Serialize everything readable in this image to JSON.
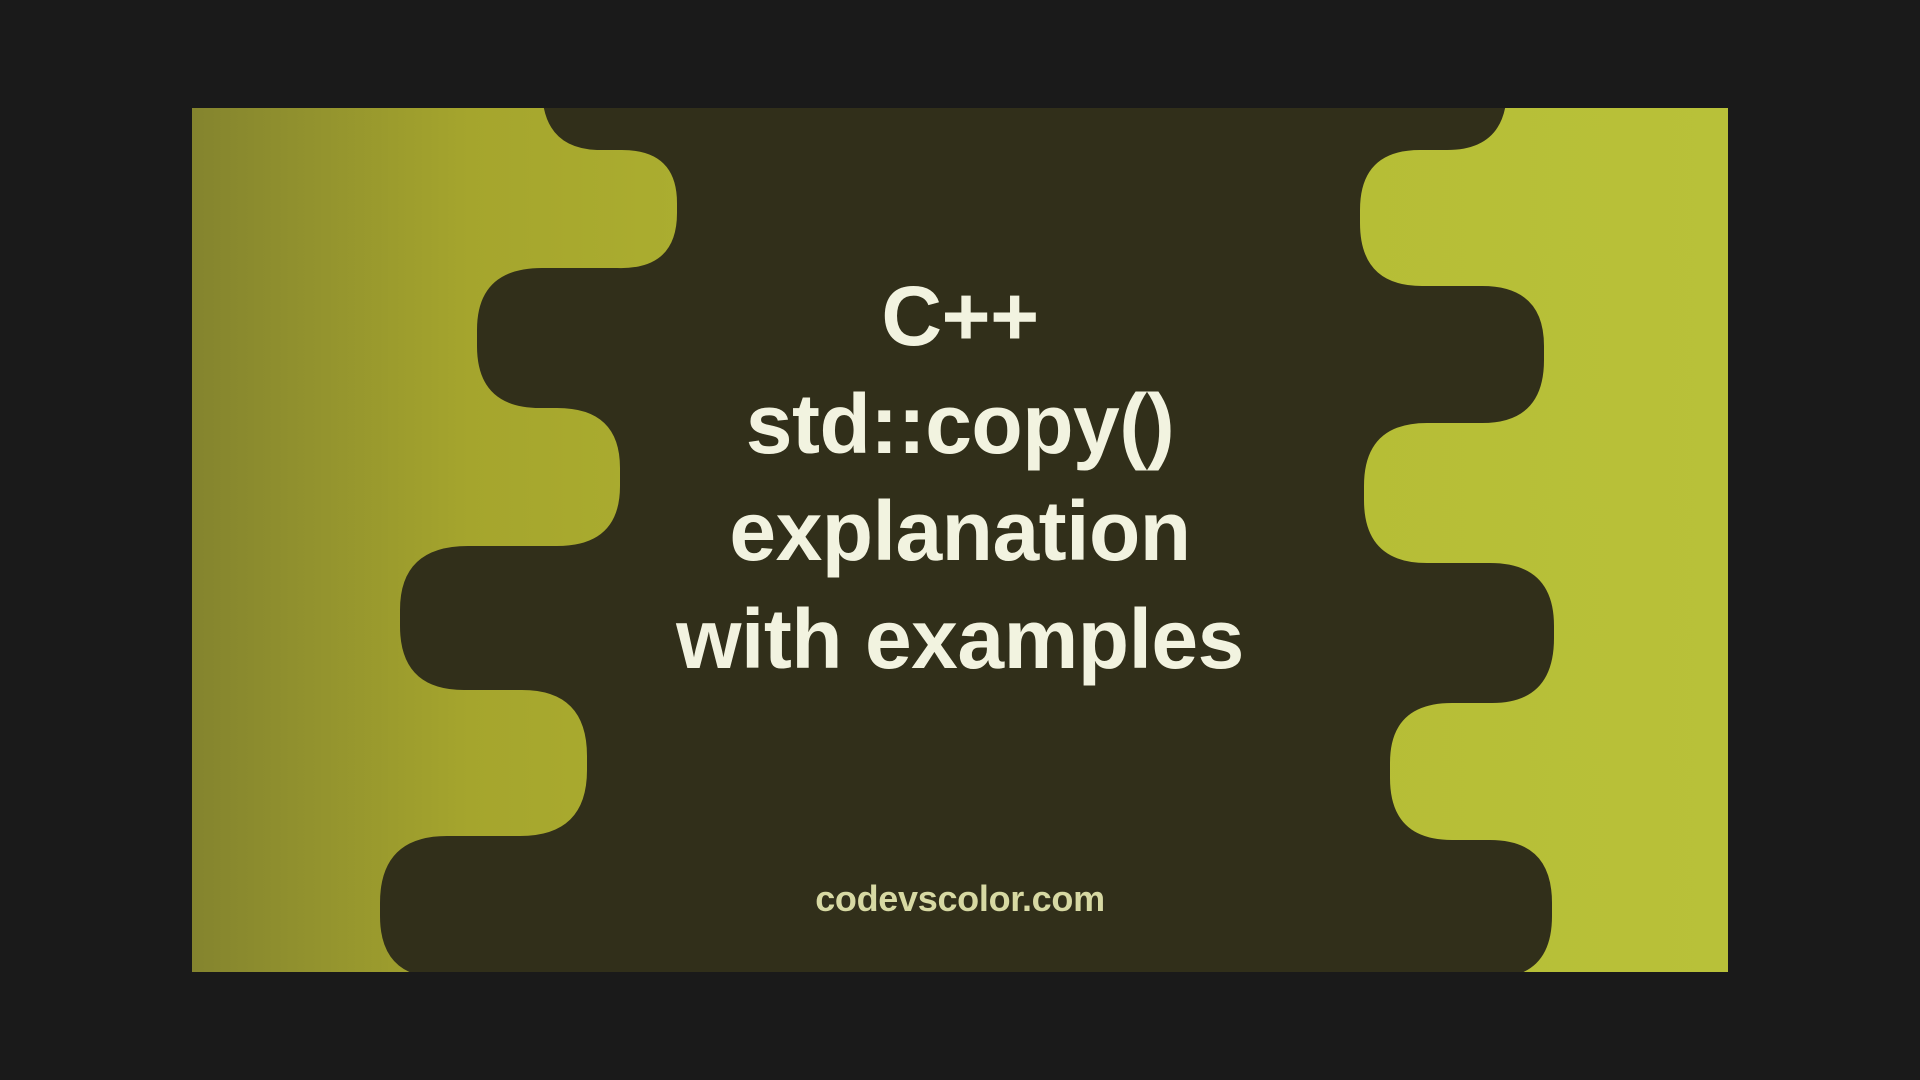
{
  "title": {
    "line1": "C++",
    "line2": "std::copy()",
    "line3": "explanation",
    "line4": "with examples"
  },
  "attribution": "codevscolor.com",
  "colors": {
    "blob": "#312f1a",
    "bg_left": "#84842e",
    "bg_right": "#b8c139",
    "text_main": "#f2f3e0",
    "text_sub": "#d7d9a3"
  }
}
